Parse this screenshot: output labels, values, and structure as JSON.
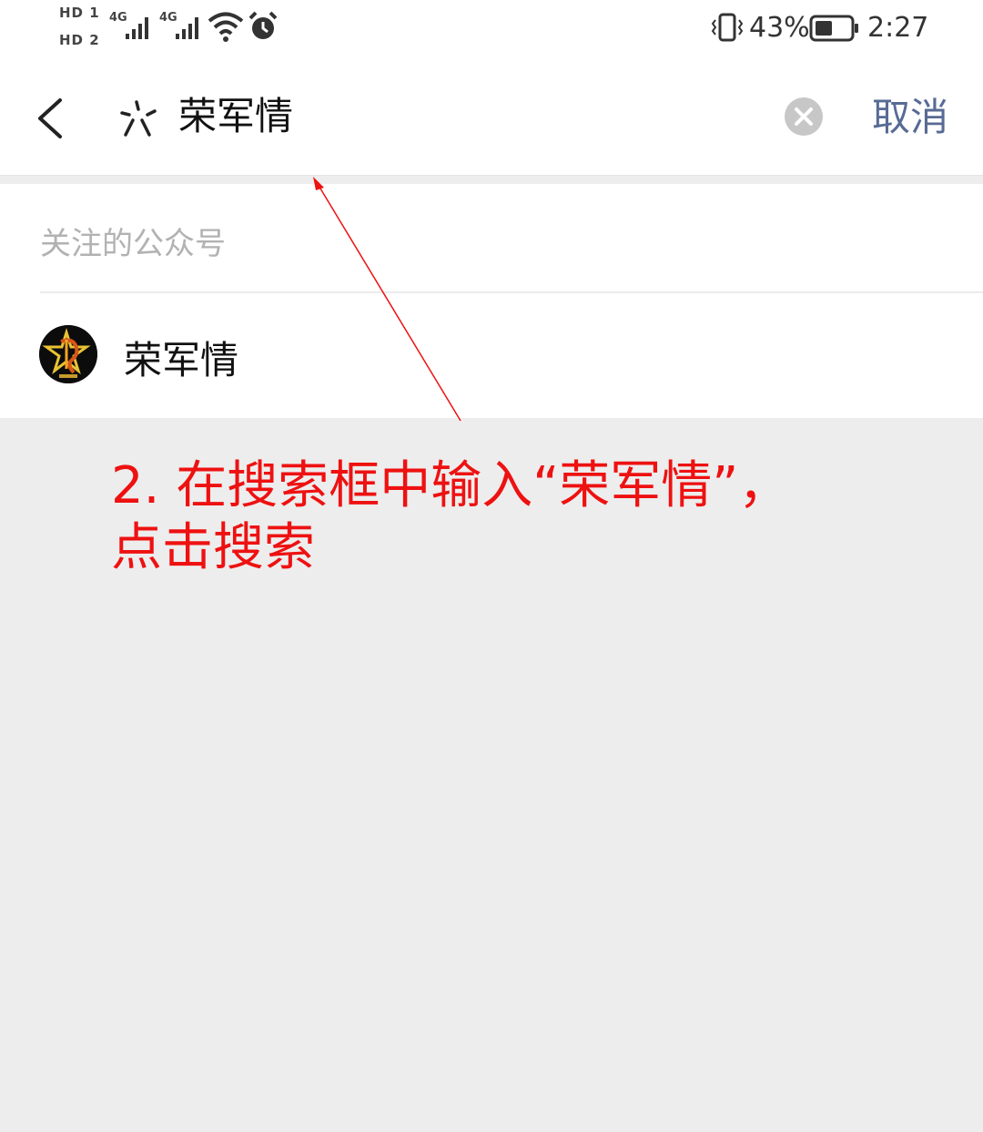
{
  "status_bar": {
    "sim1_label": "HD 1",
    "sim2_label": "HD 2",
    "sim1_network": "4G",
    "sim2_network": "4G",
    "battery_percent": "43%",
    "time": "2:27",
    "icons": [
      "signal-icon",
      "wifi-icon",
      "alarm-icon",
      "vibrate-icon",
      "battery-icon"
    ]
  },
  "search": {
    "query": "荣军情",
    "cancel_label": "取消",
    "icons": [
      "back-arrow-icon",
      "search-prefix-icon",
      "clear-icon"
    ]
  },
  "results": {
    "section_title": "关注的公众号",
    "items": [
      {
        "name": "荣军情",
        "avatar_icon": "account-avatar"
      }
    ]
  },
  "annotation": {
    "line1": "2. 在搜索框中输入“荣军情”，",
    "line2": "点击搜索",
    "color": "#ee1111"
  },
  "colors": {
    "link": "#576b95",
    "background": "#ededed",
    "annotation": "#ee1111"
  }
}
